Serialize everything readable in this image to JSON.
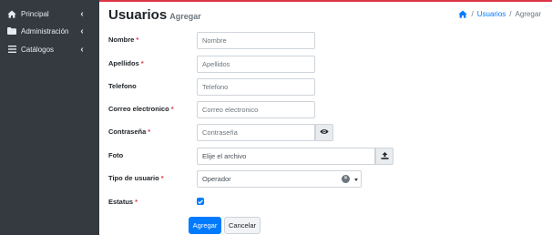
{
  "sidebar": {
    "items": [
      {
        "label": "Principal",
        "icon": "home-icon"
      },
      {
        "label": "Administración",
        "icon": "folder-icon"
      },
      {
        "label": "Catálogos",
        "icon": "list-icon"
      }
    ]
  },
  "header": {
    "title": "Usuarios",
    "subtitle": "Agregar"
  },
  "breadcrumb": {
    "separator": "/",
    "link": "Usuarios",
    "current": "Agregar"
  },
  "form": {
    "required_mark": "*",
    "nombre": {
      "label": "Nombre",
      "placeholder": "Nombre"
    },
    "apellidos": {
      "label": "Apellidos",
      "placeholder": "Apellidos"
    },
    "telefono": {
      "label": "Telefono",
      "placeholder": "Telefono"
    },
    "correo": {
      "label": "Correo electronico",
      "placeholder": "Correo electronico"
    },
    "contrasena": {
      "label": "Contraseña",
      "placeholder": "Contraseña"
    },
    "foto": {
      "label": "Foto",
      "placeholder": "Elije el archivo"
    },
    "tipo": {
      "label": "Tipo de usuario",
      "value": "Operador",
      "clear": "×"
    },
    "estatus": {
      "label": "Estatus",
      "checked": true
    }
  },
  "actions": {
    "submit": "Agregar",
    "cancel": "Cancelar"
  },
  "colors": {
    "sidebar_bg": "#343a40",
    "primary": "#007bff",
    "required": "#dc3545",
    "top_accent": "#dc3545"
  }
}
